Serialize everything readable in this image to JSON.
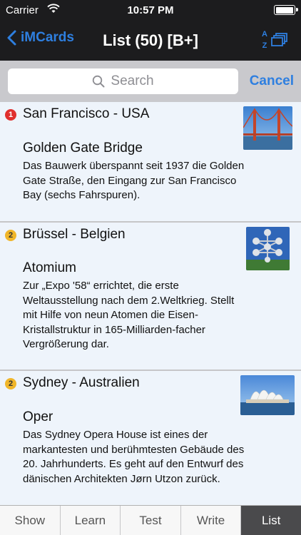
{
  "status": {
    "carrier": "Carrier",
    "time": "10:57 PM",
    "battery_level": 0.85
  },
  "nav": {
    "back_label": "iMCards",
    "title": "List (50) [B+]",
    "sort_icon": "az-sort-icon"
  },
  "search": {
    "placeholder": "Search",
    "cancel_label": "Cancel"
  },
  "cards": [
    {
      "badge": "1",
      "heading": "San Francisco - USA",
      "subtitle": "Golden Gate Bridge",
      "description": "Das Bauwerk überspannt seit 1937 die Golden Gate Straße, den Eingang zur San Francisco Bay (sechs Fahrspuren).",
      "image": "golden-gate-bridge-photo"
    },
    {
      "badge": "2",
      "heading": "Brüssel - Belgien",
      "subtitle": "Atomium",
      "description": "Zur „Expo '58“ errichtet, die erste Weltausstellung nach dem 2.Weltkrieg. Stellt mit Hilfe von neun Atomen die Eisen-Kristallstruktur in 165-Milliarden-facher Vergrößerung dar.",
      "image": "atomium-photo"
    },
    {
      "badge": "2",
      "heading": "Sydney - Australien",
      "subtitle": "Oper",
      "description": "Das Sydney Opera House ist eines der markantesten und berühmtesten Gebäude des 20. Jahrhunderts. Es geht auf den Entwurf des dänischen Architekten Jørn Utzon zurück.",
      "image": "sydney-opera-house-photo"
    }
  ],
  "tabs": [
    {
      "label": "Show"
    },
    {
      "label": "Learn"
    },
    {
      "label": "Test"
    },
    {
      "label": "Write"
    },
    {
      "label": "List",
      "active": true
    }
  ],
  "colors": {
    "accent": "#2e7fe0",
    "badge_red": "#e0302e",
    "badge_yellow": "#f0b62a",
    "card_bg": "#eef4fb"
  }
}
